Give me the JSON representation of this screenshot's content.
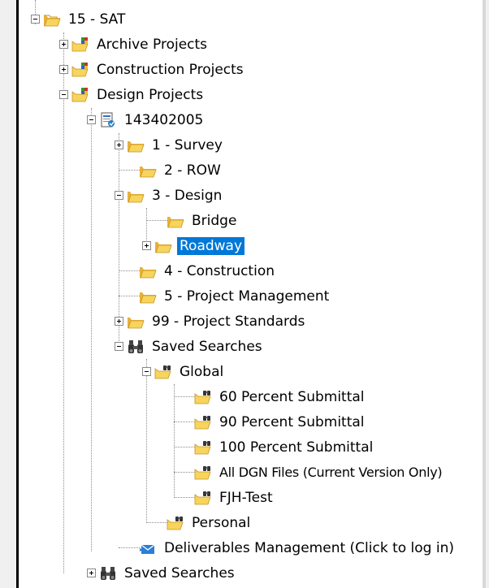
{
  "tree": {
    "nodes": [
      {
        "label": "15 - SAT",
        "expander": "minus",
        "icon": "folder-icon"
      },
      {
        "label": "Archive Projects",
        "expander": "plus",
        "icon": "folder-puzzle-icon"
      },
      {
        "label": "Construction Projects",
        "expander": "plus",
        "icon": "folder-puzzle-icon"
      },
      {
        "label": "Design Projects",
        "expander": "minus",
        "icon": "folder-puzzle-icon"
      },
      {
        "label": "143402005",
        "expander": "minus",
        "icon": "project-document-icon"
      },
      {
        "label": "1 - Survey",
        "expander": "plus",
        "icon": "folder-icon"
      },
      {
        "label": "2 - ROW",
        "expander": "none",
        "icon": "folder-icon"
      },
      {
        "label": "3 - Design",
        "expander": "minus",
        "icon": "folder-icon"
      },
      {
        "label": "Bridge",
        "expander": "none",
        "icon": "folder-icon"
      },
      {
        "label": "Roadway",
        "expander": "plus",
        "icon": "folder-icon",
        "selected": true
      },
      {
        "label": "4 - Construction",
        "expander": "none",
        "icon": "folder-icon"
      },
      {
        "label": "5 - Project Management",
        "expander": "none",
        "icon": "folder-icon"
      },
      {
        "label": "99 - Project Standards",
        "expander": "plus",
        "icon": "folder-icon"
      },
      {
        "label": "Saved Searches",
        "expander": "minus",
        "icon": "binoculars-icon"
      },
      {
        "label": "Global",
        "expander": "minus",
        "icon": "folder-binoculars-icon"
      },
      {
        "label": "60 Percent Submittal",
        "expander": "none",
        "icon": "folder-binoculars-icon"
      },
      {
        "label": "90 Percent Submittal",
        "expander": "none",
        "icon": "folder-binoculars-icon"
      },
      {
        "label": "100 Percent Submittal",
        "expander": "none",
        "icon": "folder-binoculars-icon"
      },
      {
        "label": "All DGN Files (Current Version Only)",
        "expander": "none",
        "icon": "folder-binoculars-icon"
      },
      {
        "label": "FJH-Test",
        "expander": "none",
        "icon": "folder-binoculars-icon"
      },
      {
        "label": "Personal",
        "expander": "none",
        "icon": "folder-binoculars-icon"
      },
      {
        "label": "Deliverables Management (Click to log in)",
        "expander": "none",
        "icon": "deliverables-icon"
      },
      {
        "label": "Saved Searches",
        "expander": "plus",
        "icon": "binoculars-icon"
      }
    ]
  },
  "colors": {
    "selection": "#0078d7",
    "folder": "#f5c542",
    "tree_lines": "#8c8c8c"
  }
}
